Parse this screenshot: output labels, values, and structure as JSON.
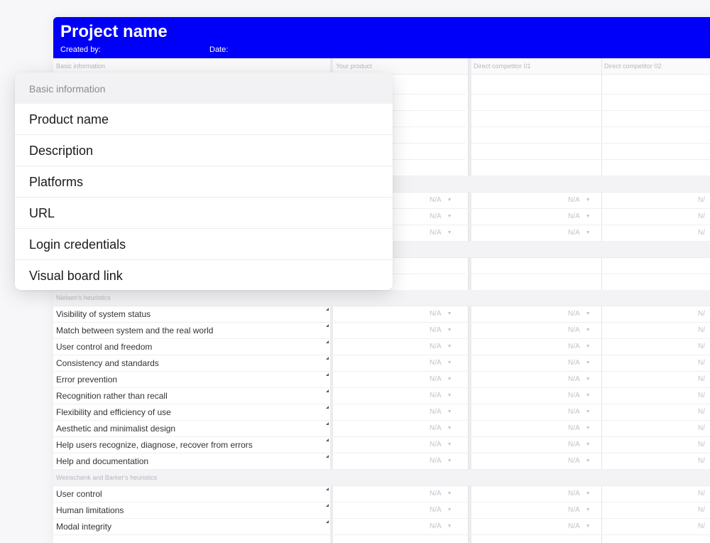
{
  "header": {
    "title": "Project name",
    "created_by_label": "Created by:",
    "date_label": "Date:",
    "background": "#0000fa"
  },
  "columns": {
    "first": "Basic information",
    "c1": "Your product",
    "c2": "Direct competitor 01",
    "c3": "Direct competitor 02"
  },
  "na": "N/A",
  "na_partial": "N/",
  "popup": {
    "header": "Basic information",
    "items": [
      "Product name",
      "Description",
      "Platforms",
      "URL",
      "Login credentials",
      "Visual board link"
    ]
  },
  "sections": {
    "nielsen": "Nielsen's heuristics",
    "weinschenk": "Weinschenk and Barker's heuristics"
  },
  "nielsen_rows": [
    "Visibility of system status",
    "Match between system and the real world",
    "User control and freedom",
    "Consistency and standards",
    "Error prevention",
    "Recognition rather than recall",
    "Flexibility and efficiency of use",
    "Aesthetic and minimalist design",
    "Help users recognize, diagnose, recover from errors",
    "Help and documentation"
  ],
  "weinschenk_rows": [
    "User control",
    "Human limitations",
    "Modal integrity"
  ]
}
